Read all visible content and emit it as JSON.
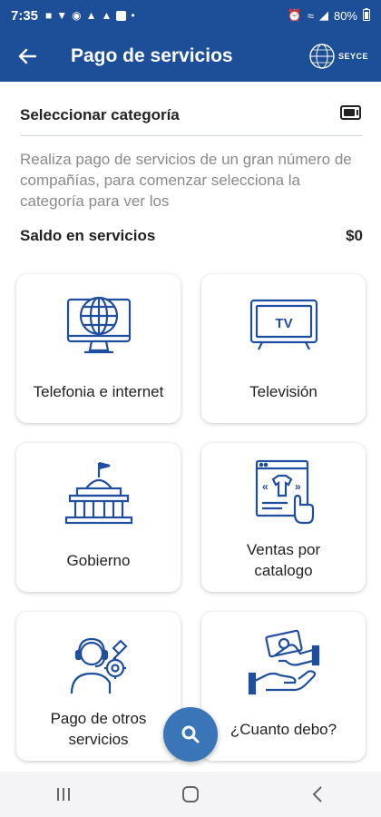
{
  "status_bar": {
    "time": "7:35",
    "battery": "80%",
    "notification_icons": [
      "message-icon",
      "chat-icon",
      "messenger-icon",
      "snapchat-icon",
      "snapchat-icon",
      "gallery-icon"
    ],
    "system_icons": [
      "alarm-icon",
      "wifi-icon",
      "signal-icon",
      "battery-icon"
    ]
  },
  "app_bar": {
    "back_icon": "arrow-left-icon",
    "title": "Pago de servicios",
    "logo_text": "SEYCE"
  },
  "category": {
    "title": "Seleccionar categoría",
    "icon": "wallet-icon"
  },
  "description": "Realiza pago de servicios de un gran número de compañías, para comenzar selecciona la categoría para ver los",
  "balance": {
    "label": "Saldo en servicios",
    "value": "$0"
  },
  "categories": [
    {
      "label": "Telefonia e internet",
      "icon": "globe-monitor-icon"
    },
    {
      "label": "Televisión",
      "icon": "tv-icon"
    },
    {
      "label": "Gobierno",
      "icon": "government-building-icon"
    },
    {
      "label": "Ventas por catalogo",
      "icon": "catalog-shopping-icon"
    },
    {
      "label": "Pago de otros servicios",
      "icon": "support-agent-icon"
    },
    {
      "label": "¿Cuanto debo?",
      "icon": "money-hand-icon"
    }
  ],
  "fab_icon": "search-icon",
  "colors": {
    "primary": "#1c4f97",
    "accent": "#3a75b8",
    "icon_blue": "#1f4e9e"
  },
  "nav": [
    "recents-icon",
    "home-icon",
    "back-icon"
  ]
}
